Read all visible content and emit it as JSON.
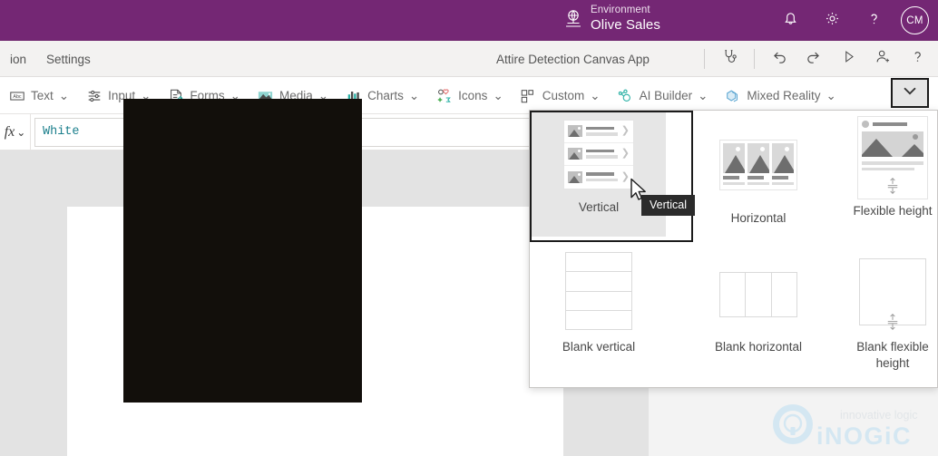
{
  "topbar": {
    "environment_label": "Environment",
    "environment_name": "Olive Sales",
    "notifications_icon": "bell-icon",
    "settings_icon": "gear-icon",
    "help_icon": "question-mark-icon",
    "avatar_initials": "CM",
    "background_color": "#742774"
  },
  "menubar": {
    "items": [
      {
        "label": "ion",
        "name": "menu-item-action"
      },
      {
        "label": "Settings",
        "name": "menu-item-settings"
      }
    ],
    "app_name": "Attire Detection Canvas App",
    "actions": [
      {
        "name": "app-checker-button",
        "icon": "stethoscope-icon"
      },
      {
        "name": "undo-button",
        "icon": "undo-arrow-icon"
      },
      {
        "name": "redo-button",
        "icon": "redo-arrow-icon"
      },
      {
        "name": "preview-button",
        "icon": "play-triangle-icon"
      },
      {
        "name": "share-button",
        "icon": "person-add-icon"
      },
      {
        "name": "help-button",
        "icon": "question-mark-icon"
      }
    ]
  },
  "ribbon": {
    "items": [
      {
        "label": "Text",
        "icon": "abc-text-icon",
        "caret": "⌄"
      },
      {
        "label": "Input",
        "icon": "sliders-icon",
        "caret": "⌄"
      },
      {
        "label": "Forms",
        "icon": "form-pencil-icon",
        "caret": "⌄"
      },
      {
        "label": "Media",
        "icon": "picture-icon",
        "caret": "⌄"
      },
      {
        "label": "Charts",
        "icon": "bar-chart-icon",
        "caret": "⌄"
      },
      {
        "label": "Icons",
        "icon": "shapes-icon",
        "caret": "⌄"
      },
      {
        "label": "Custom",
        "icon": "custom-blocks-icon",
        "caret": "⌄"
      },
      {
        "label": "AI Builder",
        "icon": "ai-nodes-icon",
        "caret": "⌄"
      },
      {
        "label": "Mixed Reality",
        "icon": "mixed-reality-icon",
        "caret": "⌄"
      }
    ],
    "expand_button": {
      "name": "expand-ribbon-button",
      "icon": "chevron-down-icon"
    }
  },
  "formula_bar": {
    "fx_label": "fx",
    "fx_caret": "⌄",
    "value": "White",
    "placeholder": "",
    "value_color": "#1b7f8c"
  },
  "gallery_panel": {
    "items": [
      {
        "label": "Vertical",
        "thumb": "vertical-gallery-thumb",
        "selected": true
      },
      {
        "label": "Horizontal",
        "thumb": "horizontal-gallery-thumb",
        "selected": false
      },
      {
        "label": "Flexible height",
        "thumb": "flexible-height-gallery-thumb",
        "selected": false
      },
      {
        "label": "Blank vertical",
        "thumb": "blank-vertical-thumb",
        "selected": false
      },
      {
        "label": "Blank horizontal",
        "thumb": "blank-horizontal-thumb",
        "selected": false
      },
      {
        "label": "Blank flexible height",
        "thumb": "blank-flexible-height-thumb",
        "selected": false
      }
    ],
    "tooltip": "Vertical"
  },
  "watermark": {
    "tagline": "innovative logic",
    "brand": "iNOGiC"
  }
}
